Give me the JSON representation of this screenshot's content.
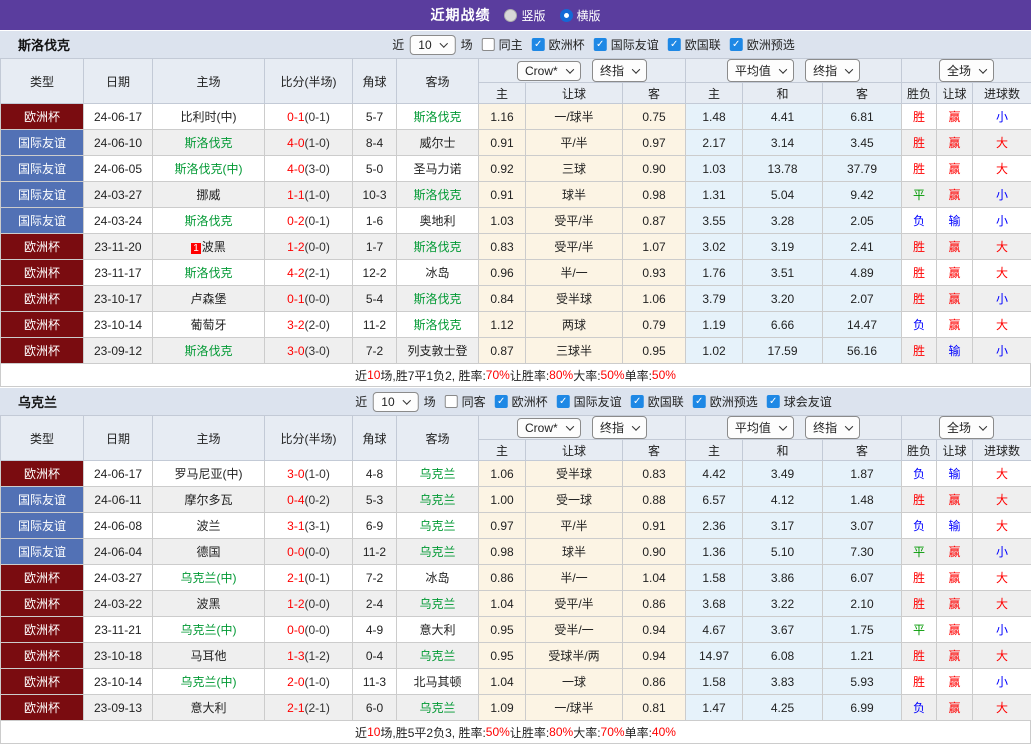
{
  "colors": {
    "topbar_purple": "#5a3d9e",
    "section_header_bg": "#dce3ee",
    "type_eurocup_bg": "#7a0c10",
    "type_friendly_bg": "#5271b5",
    "team_green": "#009933",
    "score_red": "#ff0000",
    "result_red": "#ff0000",
    "result_green": "#009900",
    "result_blue": "#0000ff",
    "handicap_col_bg": "#fcf4e4",
    "avg_col_bg": "#e6f2fa",
    "checkbox_blue": "#1e88e5"
  },
  "topbar": {
    "title": "近期战绩",
    "radios": [
      {
        "label": "竖版",
        "selected": false
      },
      {
        "label": "横版",
        "selected": true
      }
    ]
  },
  "sections": [
    {
      "team": "斯洛伐克",
      "near_label": "近",
      "near_value": "10",
      "games_label": "场",
      "same_label": "同主",
      "same_checked": false,
      "competitions": [
        {
          "label": "欧洲杯",
          "checked": true
        },
        {
          "label": "国际友谊",
          "checked": true
        },
        {
          "label": "欧国联",
          "checked": true
        },
        {
          "label": "欧洲预选",
          "checked": true
        }
      ],
      "columns": [
        "类型",
        "日期",
        "主场",
        "比分(半场)",
        "角球",
        "客场"
      ],
      "group_selects": {
        "odds": [
          "Crow*",
          "终指"
        ],
        "avg": [
          "平均值",
          "终指"
        ],
        "full": [
          "全场"
        ]
      },
      "sub_columns": {
        "odds": [
          "主",
          "让球",
          "客"
        ],
        "avg": [
          "主",
          "和",
          "客"
        ],
        "result": [
          "胜负",
          "让球",
          "进球数"
        ]
      },
      "rows": [
        {
          "type": "欧洲杯",
          "type_style": "maroon",
          "date": "24-06-17",
          "home": "比利时(中)",
          "home_green": false,
          "home_badge": "",
          "score": "0-1",
          "half": "(0-1)",
          "corners": "5-7",
          "away": "斯洛伐克",
          "away_green": true,
          "odds": [
            "1.16",
            "一/球半",
            "0.75"
          ],
          "avg": [
            "1.48",
            "4.41",
            "6.81"
          ],
          "result": [
            [
              "胜",
              "r"
            ],
            [
              "赢",
              "r"
            ],
            [
              "小",
              "b"
            ]
          ]
        },
        {
          "type": "国际友谊",
          "type_style": "blue",
          "date": "24-06-10",
          "home": "斯洛伐克",
          "home_green": true,
          "home_badge": "",
          "score": "4-0",
          "half": "(1-0)",
          "corners": "8-4",
          "away": "威尔士",
          "away_green": false,
          "odds": [
            "0.91",
            "平/半",
            "0.97"
          ],
          "avg": [
            "2.17",
            "3.14",
            "3.45"
          ],
          "result": [
            [
              "胜",
              "r"
            ],
            [
              "赢",
              "r"
            ],
            [
              "大",
              "r"
            ]
          ]
        },
        {
          "type": "国际友谊",
          "type_style": "blue",
          "date": "24-06-05",
          "home": "斯洛伐克(中)",
          "home_green": true,
          "home_badge": "",
          "score": "4-0",
          "half": "(3-0)",
          "corners": "5-0",
          "away": "圣马力诺",
          "away_green": false,
          "odds": [
            "0.92",
            "三球",
            "0.90"
          ],
          "avg": [
            "1.03",
            "13.78",
            "37.79"
          ],
          "result": [
            [
              "胜",
              "r"
            ],
            [
              "赢",
              "r"
            ],
            [
              "大",
              "r"
            ]
          ]
        },
        {
          "type": "国际友谊",
          "type_style": "blue",
          "date": "24-03-27",
          "home": "挪威",
          "home_green": false,
          "home_badge": "",
          "score": "1-1",
          "half": "(1-0)",
          "corners": "10-3",
          "away": "斯洛伐克",
          "away_green": true,
          "odds": [
            "0.91",
            "球半",
            "0.98"
          ],
          "avg": [
            "1.31",
            "5.04",
            "9.42"
          ],
          "result": [
            [
              "平",
              "g"
            ],
            [
              "赢",
              "r"
            ],
            [
              "小",
              "b"
            ]
          ]
        },
        {
          "type": "国际友谊",
          "type_style": "blue",
          "date": "24-03-24",
          "home": "斯洛伐克",
          "home_green": true,
          "home_badge": "",
          "score": "0-2",
          "half": "(0-1)",
          "corners": "1-6",
          "away": "奥地利",
          "away_green": false,
          "odds": [
            "1.03",
            "受平/半",
            "0.87"
          ],
          "avg": [
            "3.55",
            "3.28",
            "2.05"
          ],
          "result": [
            [
              "负",
              "b"
            ],
            [
              "输",
              "b"
            ],
            [
              "小",
              "b"
            ]
          ]
        },
        {
          "type": "欧洲杯",
          "type_style": "maroon",
          "date": "23-11-20",
          "home": "波黑",
          "home_green": false,
          "home_badge": "1",
          "score": "1-2",
          "half": "(0-0)",
          "corners": "1-7",
          "away": "斯洛伐克",
          "away_green": true,
          "odds": [
            "0.83",
            "受平/半",
            "1.07"
          ],
          "avg": [
            "3.02",
            "3.19",
            "2.41"
          ],
          "result": [
            [
              "胜",
              "r"
            ],
            [
              "赢",
              "r"
            ],
            [
              "大",
              "r"
            ]
          ]
        },
        {
          "type": "欧洲杯",
          "type_style": "maroon",
          "date": "23-11-17",
          "home": "斯洛伐克",
          "home_green": true,
          "home_badge": "",
          "score": "4-2",
          "half": "(2-1)",
          "corners": "12-2",
          "away": "冰岛",
          "away_green": false,
          "odds": [
            "0.96",
            "半/一",
            "0.93"
          ],
          "avg": [
            "1.76",
            "3.51",
            "4.89"
          ],
          "result": [
            [
              "胜",
              "r"
            ],
            [
              "赢",
              "r"
            ],
            [
              "大",
              "r"
            ]
          ]
        },
        {
          "type": "欧洲杯",
          "type_style": "maroon",
          "date": "23-10-17",
          "home": "卢森堡",
          "home_green": false,
          "home_badge": "",
          "score": "0-1",
          "half": "(0-0)",
          "corners": "5-4",
          "away": "斯洛伐克",
          "away_green": true,
          "odds": [
            "0.84",
            "受半球",
            "1.06"
          ],
          "avg": [
            "3.79",
            "3.20",
            "2.07"
          ],
          "result": [
            [
              "胜",
              "r"
            ],
            [
              "赢",
              "r"
            ],
            [
              "小",
              "b"
            ]
          ]
        },
        {
          "type": "欧洲杯",
          "type_style": "maroon",
          "date": "23-10-14",
          "home": "葡萄牙",
          "home_green": false,
          "home_badge": "",
          "score": "3-2",
          "half": "(2-0)",
          "corners": "11-2",
          "away": "斯洛伐克",
          "away_green": true,
          "odds": [
            "1.12",
            "两球",
            "0.79"
          ],
          "avg": [
            "1.19",
            "6.66",
            "14.47"
          ],
          "result": [
            [
              "负",
              "b"
            ],
            [
              "赢",
              "r"
            ],
            [
              "大",
              "r"
            ]
          ]
        },
        {
          "type": "欧洲杯",
          "type_style": "maroon",
          "date": "23-09-12",
          "home": "斯洛伐克",
          "home_green": true,
          "home_badge": "",
          "score": "3-0",
          "half": "(3-0)",
          "corners": "7-2",
          "away": "列支敦士登",
          "away_green": false,
          "odds": [
            "0.87",
            "三球半",
            "0.95"
          ],
          "avg": [
            "1.02",
            "17.59",
            "56.16"
          ],
          "result": [
            [
              "胜",
              "r"
            ],
            [
              "输",
              "b"
            ],
            [
              "小",
              "b"
            ]
          ]
        }
      ],
      "summary": [
        {
          "text": "近",
          "red": false
        },
        {
          "text": "10",
          "red": true
        },
        {
          "text": "场,胜7平1负2, 胜率:",
          "red": false
        },
        {
          "text": "70%",
          "red": true
        },
        {
          "text": " 让胜率:",
          "red": false
        },
        {
          "text": "80%",
          "red": true
        },
        {
          "text": " 大率:",
          "red": false
        },
        {
          "text": "50%",
          "red": true
        },
        {
          "text": " 单率:",
          "red": false
        },
        {
          "text": "50%",
          "red": true
        }
      ]
    },
    {
      "team": "乌克兰",
      "near_label": "近",
      "near_value": "10",
      "games_label": "场",
      "same_label": "同客",
      "same_checked": false,
      "competitions": [
        {
          "label": "欧洲杯",
          "checked": true
        },
        {
          "label": "国际友谊",
          "checked": true
        },
        {
          "label": "欧国联",
          "checked": true
        },
        {
          "label": "欧洲预选",
          "checked": true
        },
        {
          "label": "球会友谊",
          "checked": true
        }
      ],
      "columns": [
        "类型",
        "日期",
        "主场",
        "比分(半场)",
        "角球",
        "客场"
      ],
      "group_selects": {
        "odds": [
          "Crow*",
          "终指"
        ],
        "avg": [
          "平均值",
          "终指"
        ],
        "full": [
          "全场"
        ]
      },
      "sub_columns": {
        "odds": [
          "主",
          "让球",
          "客"
        ],
        "avg": [
          "主",
          "和",
          "客"
        ],
        "result": [
          "胜负",
          "让球",
          "进球数"
        ]
      },
      "rows": [
        {
          "type": "欧洲杯",
          "type_style": "maroon",
          "date": "24-06-17",
          "home": "罗马尼亚(中)",
          "home_green": false,
          "home_badge": "",
          "score": "3-0",
          "half": "(1-0)",
          "corners": "4-8",
          "away": "乌克兰",
          "away_green": true,
          "odds": [
            "1.06",
            "受半球",
            "0.83"
          ],
          "avg": [
            "4.42",
            "3.49",
            "1.87"
          ],
          "result": [
            [
              "负",
              "b"
            ],
            [
              "输",
              "b"
            ],
            [
              "大",
              "r"
            ]
          ]
        },
        {
          "type": "国际友谊",
          "type_style": "blue",
          "date": "24-06-11",
          "home": "摩尔多瓦",
          "home_green": false,
          "home_badge": "",
          "score": "0-4",
          "half": "(0-2)",
          "corners": "5-3",
          "away": "乌克兰",
          "away_green": true,
          "odds": [
            "1.00",
            "受一球",
            "0.88"
          ],
          "avg": [
            "6.57",
            "4.12",
            "1.48"
          ],
          "result": [
            [
              "胜",
              "r"
            ],
            [
              "赢",
              "r"
            ],
            [
              "大",
              "r"
            ]
          ]
        },
        {
          "type": "国际友谊",
          "type_style": "blue",
          "date": "24-06-08",
          "home": "波兰",
          "home_green": false,
          "home_badge": "",
          "score": "3-1",
          "half": "(3-1)",
          "corners": "6-9",
          "away": "乌克兰",
          "away_green": true,
          "odds": [
            "0.97",
            "平/半",
            "0.91"
          ],
          "avg": [
            "2.36",
            "3.17",
            "3.07"
          ],
          "result": [
            [
              "负",
              "b"
            ],
            [
              "输",
              "b"
            ],
            [
              "大",
              "r"
            ]
          ]
        },
        {
          "type": "国际友谊",
          "type_style": "blue",
          "date": "24-06-04",
          "home": "德国",
          "home_green": false,
          "home_badge": "",
          "score": "0-0",
          "half": "(0-0)",
          "corners": "11-2",
          "away": "乌克兰",
          "away_green": true,
          "odds": [
            "0.98",
            "球半",
            "0.90"
          ],
          "avg": [
            "1.36",
            "5.10",
            "7.30"
          ],
          "result": [
            [
              "平",
              "g"
            ],
            [
              "赢",
              "r"
            ],
            [
              "小",
              "b"
            ]
          ]
        },
        {
          "type": "欧洲杯",
          "type_style": "maroon",
          "date": "24-03-27",
          "home": "乌克兰(中)",
          "home_green": true,
          "home_badge": "",
          "score": "2-1",
          "half": "(0-1)",
          "corners": "7-2",
          "away": "冰岛",
          "away_green": false,
          "odds": [
            "0.86",
            "半/一",
            "1.04"
          ],
          "avg": [
            "1.58",
            "3.86",
            "6.07"
          ],
          "result": [
            [
              "胜",
              "r"
            ],
            [
              "赢",
              "r"
            ],
            [
              "大",
              "r"
            ]
          ]
        },
        {
          "type": "欧洲杯",
          "type_style": "maroon",
          "date": "24-03-22",
          "home": "波黑",
          "home_green": false,
          "home_badge": "",
          "score": "1-2",
          "half": "(0-0)",
          "corners": "2-4",
          "away": "乌克兰",
          "away_green": true,
          "odds": [
            "1.04",
            "受平/半",
            "0.86"
          ],
          "avg": [
            "3.68",
            "3.22",
            "2.10"
          ],
          "result": [
            [
              "胜",
              "r"
            ],
            [
              "赢",
              "r"
            ],
            [
              "大",
              "r"
            ]
          ]
        },
        {
          "type": "欧洲杯",
          "type_style": "maroon",
          "date": "23-11-21",
          "home": "乌克兰(中)",
          "home_green": true,
          "home_badge": "",
          "score": "0-0",
          "half": "(0-0)",
          "corners": "4-9",
          "away": "意大利",
          "away_green": false,
          "odds": [
            "0.95",
            "受半/一",
            "0.94"
          ],
          "avg": [
            "4.67",
            "3.67",
            "1.75"
          ],
          "result": [
            [
              "平",
              "g"
            ],
            [
              "赢",
              "r"
            ],
            [
              "小",
              "b"
            ]
          ]
        },
        {
          "type": "欧洲杯",
          "type_style": "maroon",
          "date": "23-10-18",
          "home": "马耳他",
          "home_green": false,
          "home_badge": "",
          "score": "1-3",
          "half": "(1-2)",
          "corners": "0-4",
          "away": "乌克兰",
          "away_green": true,
          "odds": [
            "0.95",
            "受球半/两",
            "0.94"
          ],
          "avg": [
            "14.97",
            "6.08",
            "1.21"
          ],
          "result": [
            [
              "胜",
              "r"
            ],
            [
              "赢",
              "r"
            ],
            [
              "大",
              "r"
            ]
          ]
        },
        {
          "type": "欧洲杯",
          "type_style": "maroon",
          "date": "23-10-14",
          "home": "乌克兰(中)",
          "home_green": true,
          "home_badge": "",
          "score": "2-0",
          "half": "(1-0)",
          "corners": "11-3",
          "away": "北马其顿",
          "away_green": false,
          "odds": [
            "1.04",
            "一球",
            "0.86"
          ],
          "avg": [
            "1.58",
            "3.83",
            "5.93"
          ],
          "result": [
            [
              "胜",
              "r"
            ],
            [
              "赢",
              "r"
            ],
            [
              "小",
              "b"
            ]
          ]
        },
        {
          "type": "欧洲杯",
          "type_style": "maroon",
          "date": "23-09-13",
          "home": "意大利",
          "home_green": false,
          "home_badge": "",
          "score": "2-1",
          "half": "(2-1)",
          "corners": "6-0",
          "away": "乌克兰",
          "away_green": true,
          "odds": [
            "1.09",
            "一/球半",
            "0.81"
          ],
          "avg": [
            "1.47",
            "4.25",
            "6.99"
          ],
          "result": [
            [
              "负",
              "b"
            ],
            [
              "赢",
              "r"
            ],
            [
              "大",
              "r"
            ]
          ]
        }
      ],
      "summary": [
        {
          "text": "近",
          "red": false
        },
        {
          "text": "10",
          "red": true
        },
        {
          "text": "场,胜5平2负3, 胜率:",
          "red": false
        },
        {
          "text": "50%",
          "red": true
        },
        {
          "text": " 让胜率:",
          "red": false
        },
        {
          "text": "80%",
          "red": true
        },
        {
          "text": " 大率:",
          "red": false
        },
        {
          "text": "70%",
          "red": true
        },
        {
          "text": " 单率:",
          "red": false
        },
        {
          "text": "40%",
          "red": true
        }
      ]
    }
  ]
}
